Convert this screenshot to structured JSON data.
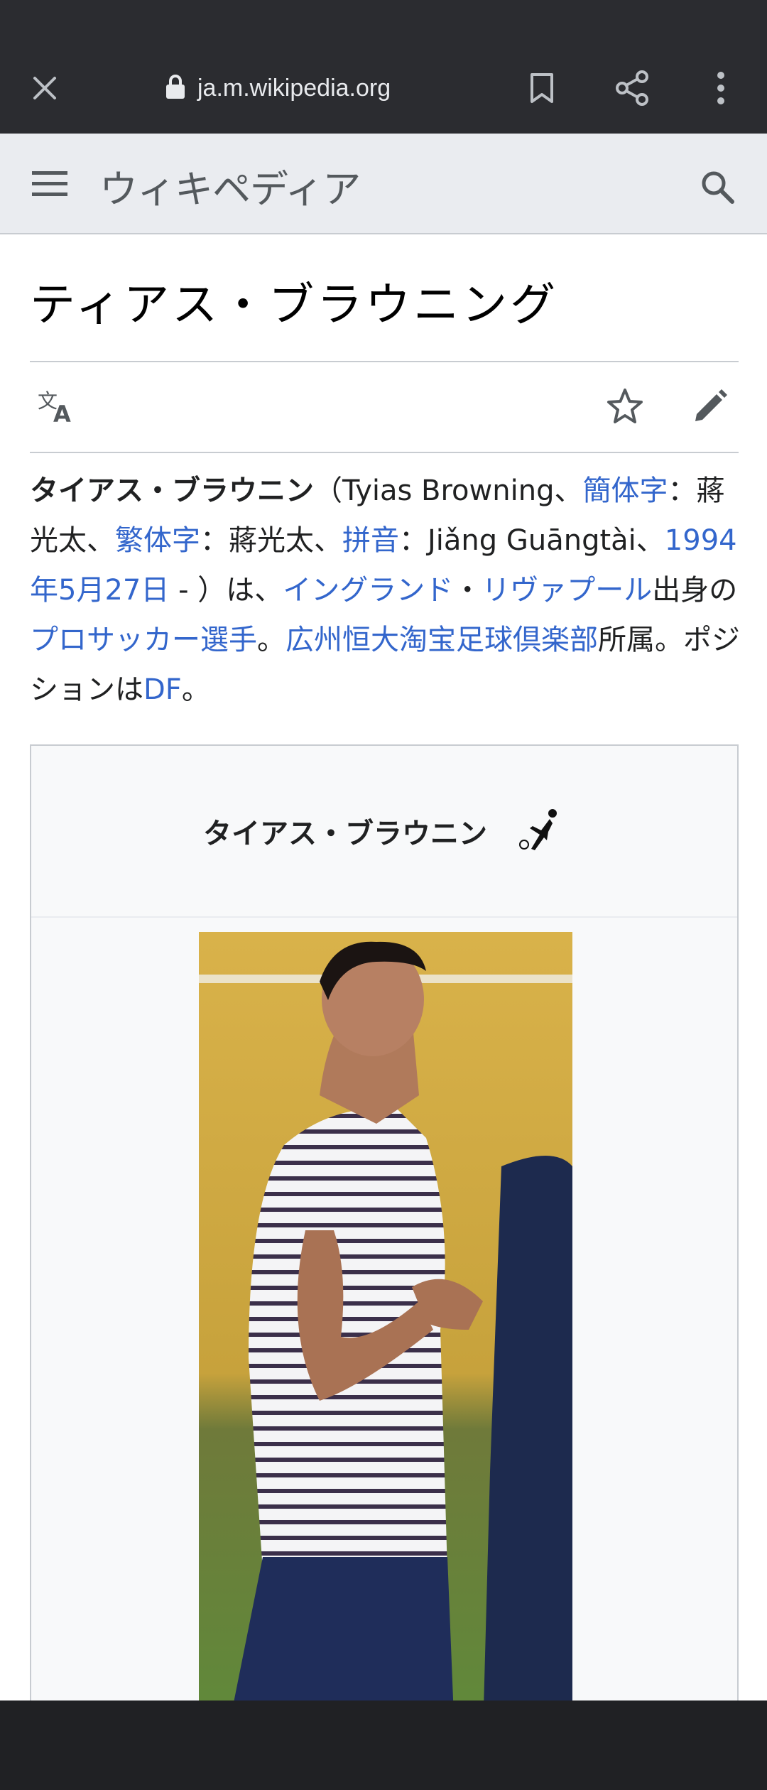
{
  "browser": {
    "url": "ja.m.wikipedia.org",
    "icons": [
      "close-icon",
      "lock-icon",
      "bookmark-icon",
      "share-icon",
      "more-vert-icon"
    ]
  },
  "wiki_header": {
    "logo_text": "ウィキペディア",
    "icons": [
      "menu-icon",
      "search-icon"
    ]
  },
  "article": {
    "title": "ティアス・ブラウニング",
    "actions_icons": [
      "language-icon",
      "star-icon",
      "edit-pencil-icon"
    ],
    "lead": {
      "name": "タイアス・ブラウニン",
      "open_paren": "（Tyias Browning、",
      "simplified_link": "簡体字",
      "colon1": "：蔣光太、",
      "traditional_link": "繁体字",
      "colon2": "：蔣光太、",
      "pinyin_link": "拼音",
      "pinyin_text": "：Jiǎng Guāngtài、",
      "birthdate_link": "1994年5月27日",
      "after_date": " - ）は、",
      "england_link": "イングランド",
      "middot": "・",
      "liverpool_link": "リヴァプール",
      "origin_text": "出身の",
      "pro_link": "プロサッカー選手",
      "period1": "。",
      "club_link": "広州恒大淘宝足球倶楽部",
      "affiliation_text": "所属。ポジションは",
      "df_link": "DF",
      "period2": "。"
    }
  },
  "infobox": {
    "title": "タイアス・ブラウニン",
    "title_icon": "football-player-icon"
  },
  "colors": {
    "chrome": "#2b2c30",
    "wiki_header_bg": "#eaecf0",
    "link": "#3366cc",
    "text": "#202122"
  }
}
